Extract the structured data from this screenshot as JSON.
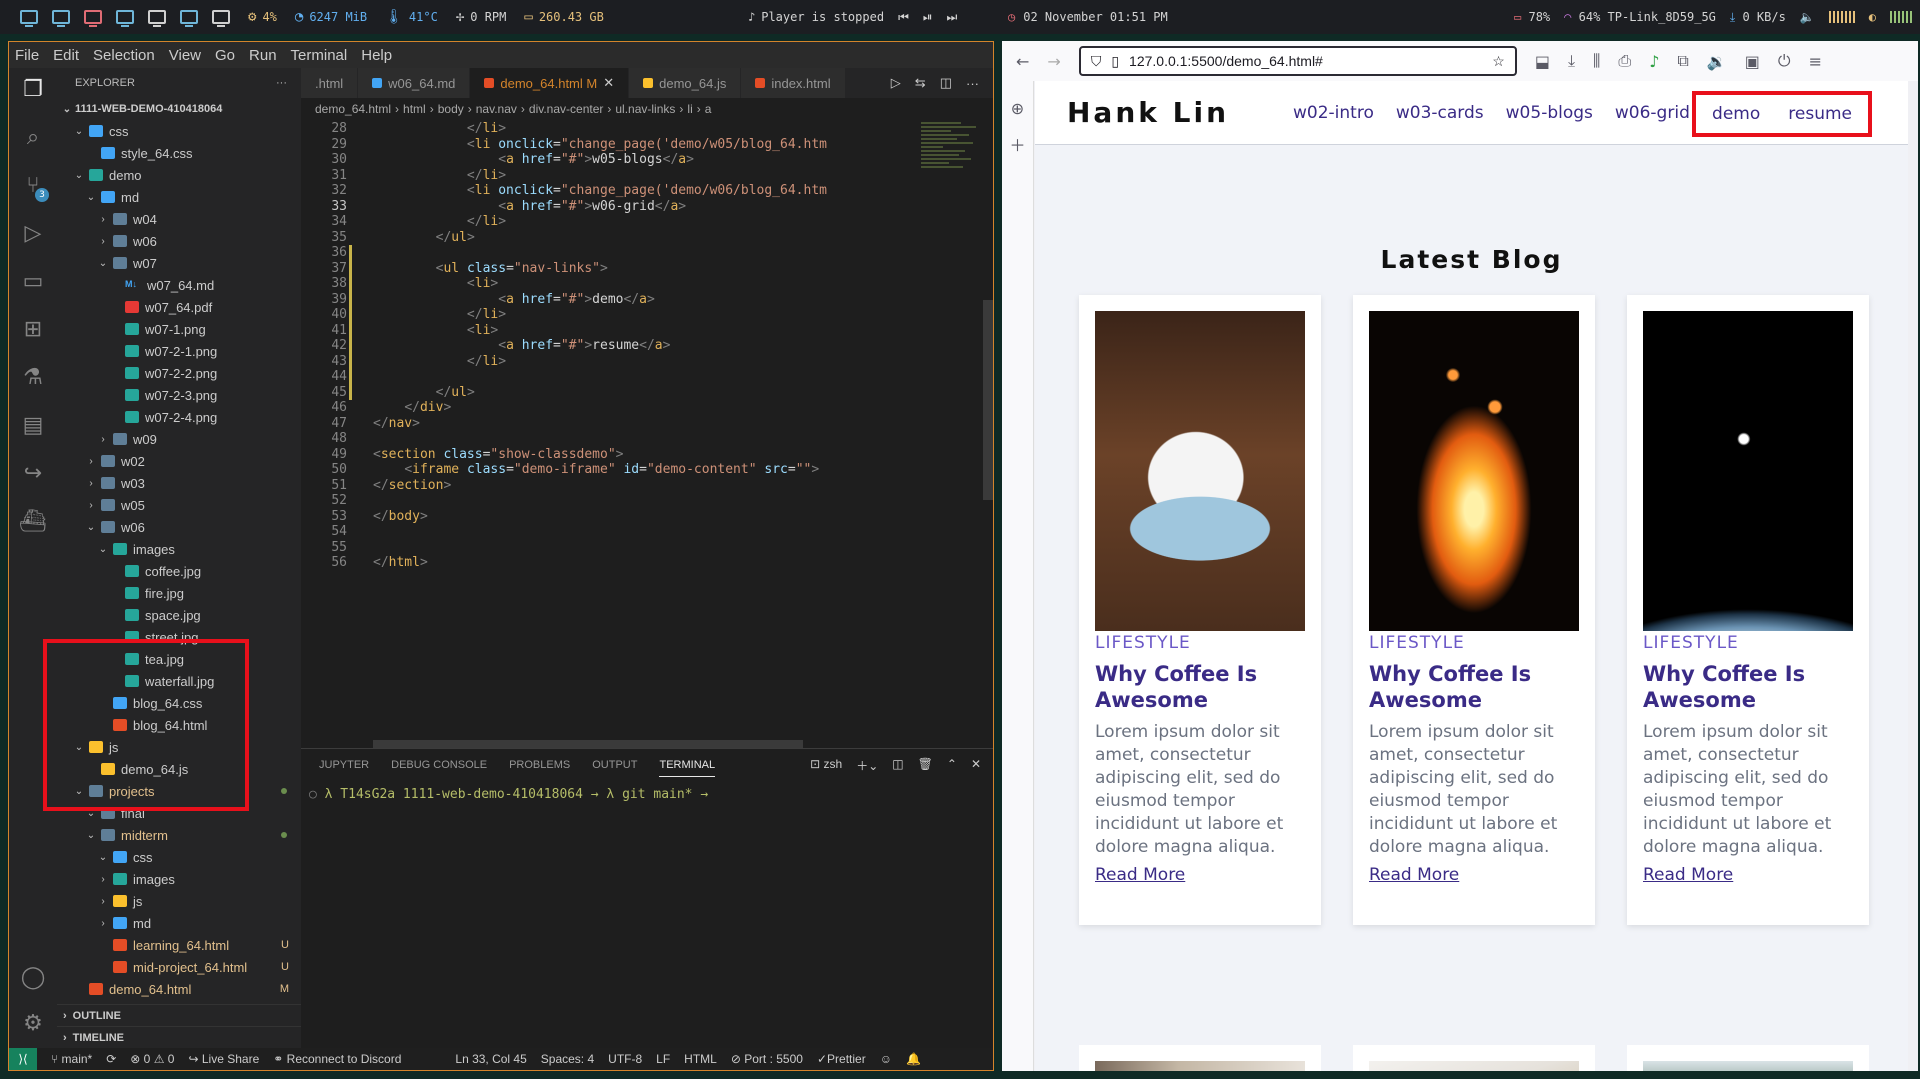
{
  "topbar": {
    "cpu": "4%",
    "mem": "6247 MiB",
    "temp": "41°C",
    "fan": "0 RPM",
    "disk": "260.43 GB",
    "player": "Player is stopped",
    "date": "02 November 01:51 PM",
    "battery": "78%",
    "wifi": "64% TP-Link_8D59_5G",
    "net": "0 KB/s"
  },
  "vscode": {
    "menu": [
      "File",
      "Edit",
      "Selection",
      "View",
      "Go",
      "Run",
      "Terminal",
      "Help"
    ],
    "explorer_title": "EXPLORER",
    "explorer_more": "···",
    "root": "1111-WEB-DEMO-410418064",
    "tree": [
      {
        "depth": 1,
        "name": "css",
        "kind": "folder-css",
        "open": true
      },
      {
        "depth": 2,
        "name": "style_64.css",
        "kind": "file-css"
      },
      {
        "depth": 1,
        "name": "demo",
        "kind": "folder-demo",
        "open": true
      },
      {
        "depth": 2,
        "name": "md",
        "kind": "folder-md",
        "open": true
      },
      {
        "depth": 3,
        "name": "w04",
        "kind": "folder",
        "open": false
      },
      {
        "depth": 3,
        "name": "w06",
        "kind": "folder",
        "open": false
      },
      {
        "depth": 3,
        "name": "w07",
        "kind": "folder",
        "open": true
      },
      {
        "depth": 4,
        "name": "w07_64.md",
        "kind": "file-md"
      },
      {
        "depth": 4,
        "name": "w07_64.pdf",
        "kind": "file-pdf"
      },
      {
        "depth": 4,
        "name": "w07-1.png",
        "kind": "file-img"
      },
      {
        "depth": 4,
        "name": "w07-2-1.png",
        "kind": "file-img"
      },
      {
        "depth": 4,
        "name": "w07-2-2.png",
        "kind": "file-img"
      },
      {
        "depth": 4,
        "name": "w07-2-3.png",
        "kind": "file-img"
      },
      {
        "depth": 4,
        "name": "w07-2-4.png",
        "kind": "file-img"
      },
      {
        "depth": 3,
        "name": "w09",
        "kind": "folder",
        "open": false
      },
      {
        "depth": 2,
        "name": "w02",
        "kind": "folder",
        "open": false
      },
      {
        "depth": 2,
        "name": "w03",
        "kind": "folder",
        "open": false
      },
      {
        "depth": 2,
        "name": "w05",
        "kind": "folder",
        "open": false
      },
      {
        "depth": 2,
        "name": "w06",
        "kind": "folder",
        "open": true
      },
      {
        "depth": 3,
        "name": "images",
        "kind": "folder-img",
        "open": true
      },
      {
        "depth": 4,
        "name": "coffee.jpg",
        "kind": "file-img"
      },
      {
        "depth": 4,
        "name": "fire.jpg",
        "kind": "file-img"
      },
      {
        "depth": 4,
        "name": "space.jpg",
        "kind": "file-img"
      },
      {
        "depth": 4,
        "name": "street.jpg",
        "kind": "file-img"
      },
      {
        "depth": 4,
        "name": "tea.jpg",
        "kind": "file-img"
      },
      {
        "depth": 4,
        "name": "waterfall.jpg",
        "kind": "file-img"
      },
      {
        "depth": 3,
        "name": "blog_64.css",
        "kind": "file-css"
      },
      {
        "depth": 3,
        "name": "blog_64.html",
        "kind": "file-html"
      },
      {
        "depth": 1,
        "name": "js",
        "kind": "folder-js",
        "open": true
      },
      {
        "depth": 2,
        "name": "demo_64.js",
        "kind": "file-js"
      },
      {
        "depth": 1,
        "name": "projects",
        "kind": "folder-proj",
        "open": true,
        "status": "dot",
        "color": "modified"
      },
      {
        "depth": 2,
        "name": "final",
        "kind": "folder",
        "open": true
      },
      {
        "depth": 2,
        "name": "midterm",
        "kind": "folder",
        "open": true,
        "status": "dot",
        "color": "modified"
      },
      {
        "depth": 3,
        "name": "css",
        "kind": "folder-css",
        "open": true
      },
      {
        "depth": 3,
        "name": "images",
        "kind": "folder-img",
        "open": false
      },
      {
        "depth": 3,
        "name": "js",
        "kind": "folder-js",
        "open": false
      },
      {
        "depth": 3,
        "name": "md",
        "kind": "folder-md",
        "open": false
      },
      {
        "depth": 3,
        "name": "learning_64.html",
        "kind": "file-html",
        "status": "U",
        "color": "modified"
      },
      {
        "depth": 3,
        "name": "mid-project_64.html",
        "kind": "file-html",
        "status": "U",
        "color": "modified"
      },
      {
        "depth": 1,
        "name": "demo_64.html",
        "kind": "file-html",
        "status": "M",
        "color": "modified"
      }
    ],
    "outline": "OUTLINE",
    "timeline": "TIMELINE",
    "tabs": [
      {
        "label": ".html",
        "active": false,
        "icon": ""
      },
      {
        "label": "w06_64.md",
        "active": false,
        "icon": "md"
      },
      {
        "label": "demo_64.html M",
        "active": true,
        "icon": "html"
      },
      {
        "label": "demo_64.js",
        "active": false,
        "icon": "js"
      },
      {
        "label": "index.html",
        "active": false,
        "icon": "html"
      }
    ],
    "breadcrumbs": [
      "demo_64.html",
      "html",
      "body",
      "nav.nav",
      "div.nav-center",
      "ul.nav-links",
      "li",
      "a"
    ],
    "code": [
      {
        "n": "28",
        "t": "            </li>"
      },
      {
        "n": "29",
        "t": "            <li onclick=\"change_page('demo/w05/blog_64.htm"
      },
      {
        "n": "30",
        "t": "                <a href=\"#\">w05-blogs</a>"
      },
      {
        "n": "31",
        "t": "            </li>"
      },
      {
        "n": "32",
        "t": "            <li onclick=\"change_page('demo/w06/blog_64.htm"
      },
      {
        "n": "33",
        "t": "                <a href=\"#\">w06-grid</a>"
      },
      {
        "n": "34",
        "t": "            </li>"
      },
      {
        "n": "35",
        "t": "        </ul>"
      },
      {
        "n": "36",
        "t": ""
      },
      {
        "n": "37",
        "t": "        <ul class=\"nav-links\">"
      },
      {
        "n": "38",
        "t": "            <li>"
      },
      {
        "n": "39",
        "t": "                <a href=\"#\">demo</a>"
      },
      {
        "n": "40",
        "t": "            </li>"
      },
      {
        "n": "41",
        "t": "            <li>"
      },
      {
        "n": "42",
        "t": "                <a href=\"#\">resume</a>"
      },
      {
        "n": "43",
        "t": "            </li>"
      },
      {
        "n": "44",
        "t": ""
      },
      {
        "n": "45",
        "t": "        </ul>"
      },
      {
        "n": "46",
        "t": "    </div>"
      },
      {
        "n": "47",
        "t": "</nav>"
      },
      {
        "n": "48",
        "t": ""
      },
      {
        "n": "49",
        "t": "<section class=\"show-classdemo\">"
      },
      {
        "n": "50",
        "t": "    <iframe class=\"demo-iframe\" id=\"demo-content\" src=\"\">"
      },
      {
        "n": "51",
        "t": "</section>"
      },
      {
        "n": "52",
        "t": ""
      },
      {
        "n": "53",
        "t": "</body>"
      },
      {
        "n": "54",
        "t": ""
      },
      {
        "n": "55",
        "t": ""
      },
      {
        "n": "56",
        "t": "</html>"
      }
    ],
    "panel_tabs": [
      "JUPYTER",
      "DEBUG CONSOLE",
      "PROBLEMS",
      "OUTPUT",
      "TERMINAL"
    ],
    "shell": "zsh",
    "terminal_line": "λ T14sG2a 1111-web-demo-410418064 → λ git main* →",
    "status": {
      "branch": "main*",
      "problems": "⊗ 0 ⚠ 0",
      "liveshare": "Live Share",
      "discord": "Reconnect to Discord",
      "position": "Ln 33, Col 45",
      "spaces": "Spaces: 4",
      "encoding": "UTF-8",
      "eol": "LF",
      "lang": "HTML",
      "port": "Port : 5500",
      "prettier": "Prettier"
    }
  },
  "browser": {
    "url": "127.0.0.1:5500/demo_64.html#",
    "site": {
      "logo": "Hank Lin",
      "nav": [
        "w02-intro",
        "w03-cards",
        "w05-blogs",
        "w06-grid"
      ],
      "nav_right": [
        "demo",
        "resume"
      ],
      "heading": "Latest Blog",
      "cards": [
        {
          "image": "coffee",
          "category": "LIFESTYLE",
          "title": "Why Coffee Is Awesome",
          "body": "Lorem ipsum dolor sit amet, consectetur adipiscing elit, sed do eiusmod tempor incididunt ut labore et dolore magna aliqua.",
          "link": "Read More"
        },
        {
          "image": "fire",
          "category": "LIFESTYLE",
          "title": "Why Coffee Is Awesome",
          "body": "Lorem ipsum dolor sit amet, consectetur adipiscing elit, sed do eiusmod tempor incididunt ut labore et dolore magna aliqua.",
          "link": "Read More"
        },
        {
          "image": "space",
          "category": "LIFESTYLE",
          "title": "Why Coffee Is Awesome",
          "body": "Lorem ipsum dolor sit amet, consectetur adipiscing elit, sed do eiusmod tempor incididunt ut labore et dolore magna aliqua.",
          "link": "Read More"
        }
      ]
    }
  }
}
